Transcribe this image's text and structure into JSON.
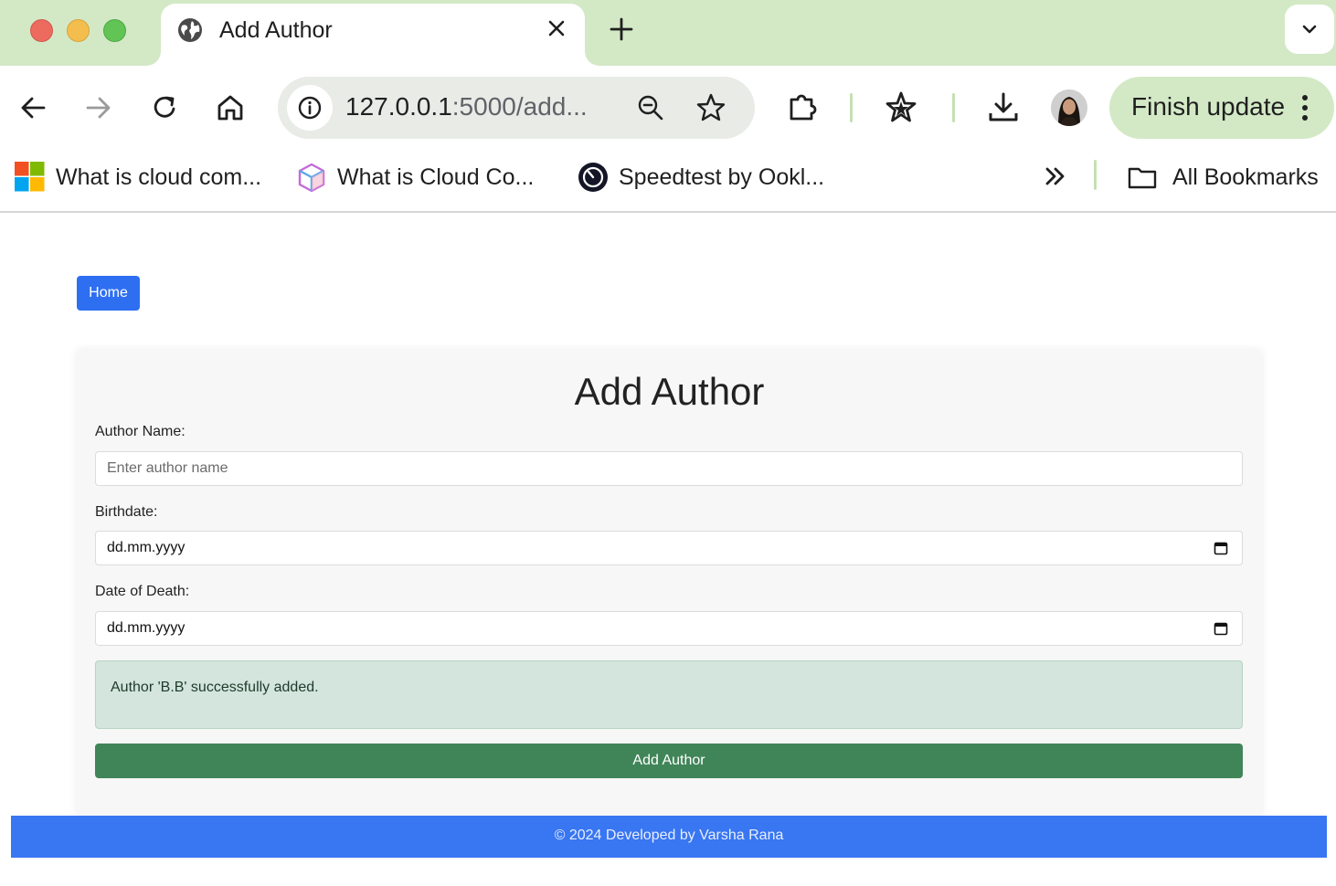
{
  "browser": {
    "tab": {
      "title": "Add Author",
      "favicon": "globe-icon"
    },
    "url": {
      "host": "127.0.0.1",
      "path": ":5000/add..."
    },
    "finish_update_label": "Finish update",
    "bookmarks": [
      {
        "label": "What is cloud com...",
        "icon": "microsoft-logo-icon"
      },
      {
        "label": "What is Cloud Co...",
        "icon": "cube-icon"
      },
      {
        "label": "Speedtest by Ookl...",
        "icon": "speedtest-icon"
      }
    ],
    "all_bookmarks_label": "All Bookmarks",
    "colors": {
      "tabstrip": "#d3e9c6",
      "accent_separator": "#c5e0b4"
    }
  },
  "page": {
    "home_label": "Home",
    "form": {
      "title": "Add Author",
      "author_name_label": "Author Name:",
      "author_name_placeholder": "Enter author name",
      "birthdate_label": "Birthdate:",
      "birthdate_value": "dd.mm.yyyy",
      "death_label": "Date of Death:",
      "death_value": "dd.mm.yyyy",
      "success_message": "Author 'B.B' successfully added.",
      "submit_label": "Add Author"
    },
    "footer_text": "© 2024 Developed by Varsha Rana",
    "colors": {
      "home_button": "#2e6ff2",
      "submit_button": "#408558",
      "alert_background": "#d3e5dd",
      "footer": "#3876f2"
    }
  }
}
